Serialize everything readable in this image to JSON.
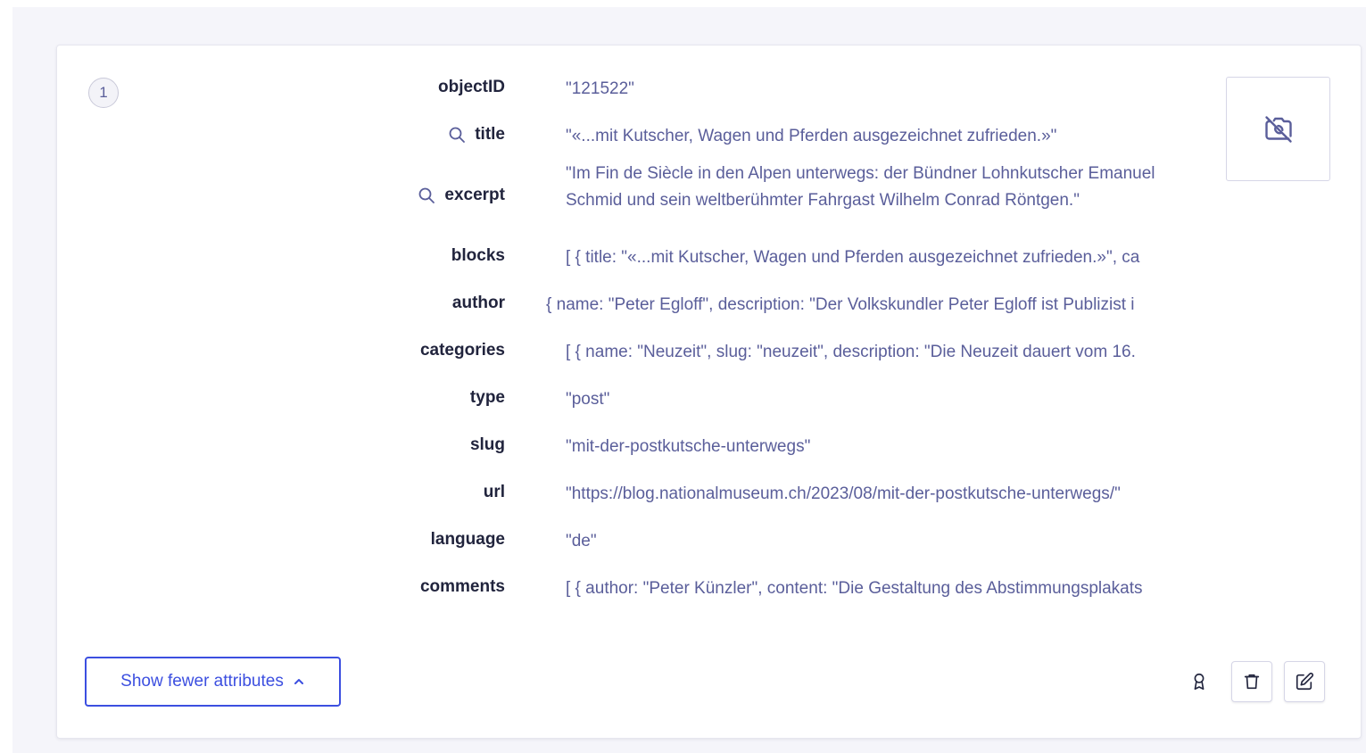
{
  "record": {
    "index": "1",
    "attributes": [
      {
        "key": "objectID",
        "value": "\"121522\"",
        "searchable": false
      },
      {
        "key": "title",
        "value": "\"«...mit Kutscher, Wagen und Pferden ausgezeichnet zufrieden.»\"",
        "searchable": true
      },
      {
        "key": "excerpt",
        "value": "\"Im Fin de Siècle in den Alpen unterwegs: der Bündner Lohnkutscher Emanuel Schmid und sein weltberühmter Fahrgast Wilhelm Conrad Röntgen.\"",
        "searchable": true
      },
      {
        "key": "blocks",
        "value": "[ { title: \"«...mit Kutscher, Wagen und Pferden ausgezeichnet zufrieden.»\", ca",
        "searchable": false
      },
      {
        "key": "author",
        "value": "{ name: \"Peter Egloff\", description: \"Der Volkskundler Peter Egloff ist Publizist i",
        "searchable": false
      },
      {
        "key": "categories",
        "value": "[ { name: \"Neuzeit\", slug: \"neuzeit\", description: \"Die Neuzeit dauert vom 16.",
        "searchable": false
      },
      {
        "key": "type",
        "value": "\"post\"",
        "searchable": false
      },
      {
        "key": "slug",
        "value": "\"mit-der-postkutsche-unterwegs\"",
        "searchable": false
      },
      {
        "key": "url",
        "value": "\"https://blog.nationalmuseum.ch/2023/08/mit-der-postkutsche-unterwegs/\"",
        "searchable": false
      },
      {
        "key": "language",
        "value": "\"de\"",
        "searchable": false
      },
      {
        "key": "comments",
        "value": "[ { author: \"Peter Künzler\", content: \"Die Gestaltung des Abstimmungsplakats",
        "searchable": false
      }
    ],
    "image": {
      "icon": "no-image-icon"
    },
    "toggle_label": "Show fewer attributes",
    "actions": {
      "rank_icon": "award-icon",
      "delete_icon": "trash-icon",
      "edit_icon": "edit-icon"
    }
  },
  "colors": {
    "accent": "#3c4fe0",
    "value_text": "#5a5e9a",
    "key_text": "#21243d"
  }
}
